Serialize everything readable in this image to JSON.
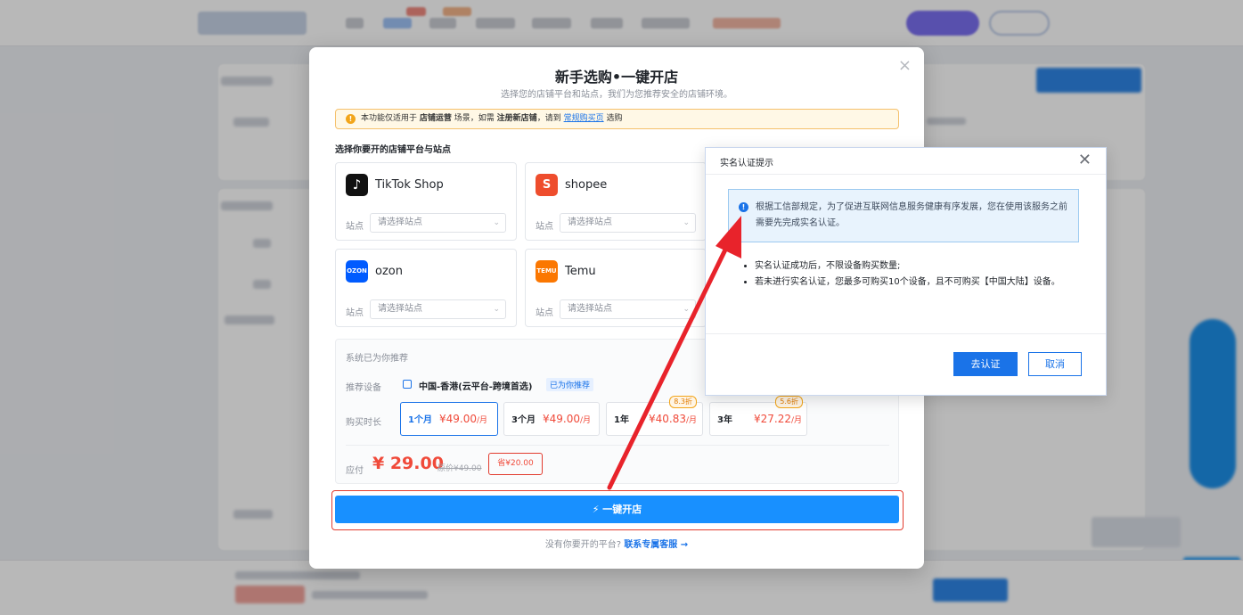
{
  "dialog": {
    "title": "新手选购•一键开店",
    "subtitle": "选择您的店铺平台和站点，我们为您推荐安全的店铺环境。",
    "close_icon": "×",
    "notice": {
      "icon": "!",
      "prefix": "本功能仅适用于",
      "bold1": "店铺运营",
      "mid1": "场景，如需",
      "bold2": "注册新店铺",
      "mid2": "，请到",
      "link": "常规购买页",
      "suffix": "选购"
    },
    "section_title": "选择你要开的店铺平台与站点",
    "platforms": [
      {
        "name": "TikTok Shop",
        "logo": "♪",
        "logo_color": "#111111",
        "site_label": "站点",
        "placeholder": "请选择站点"
      },
      {
        "name": "shopee",
        "logo": "S",
        "logo_color": "#ee4d2d",
        "site_label": "站点",
        "placeholder": "请选择站点"
      },
      {
        "name": "ozon",
        "logo": "OZON",
        "logo_color": "#005bff",
        "site_label": "站点",
        "placeholder": "请选择站点"
      },
      {
        "name": "Temu",
        "logo": "TEMU",
        "logo_color": "#fb7701",
        "site_label": "站点",
        "placeholder": "请选择站点"
      }
    ],
    "recommend": {
      "title": "系统已为你推荐",
      "device_label": "推荐设备",
      "device": "中国-香港(云平台-跨境首选)",
      "device_badge": "已为你推荐",
      "duration_label": "购买时长",
      "durations": [
        {
          "name": "1个月",
          "price": "¥49.00",
          "unit": "/月",
          "tag": "",
          "selected": true
        },
        {
          "name": "3个月",
          "price": "¥49.00",
          "unit": "/月",
          "tag": "",
          "selected": false
        },
        {
          "name": "1年",
          "price": "¥40.83",
          "unit": "/月",
          "tag": "8.3折",
          "selected": false
        },
        {
          "name": "3年",
          "price": "¥27.22",
          "unit": "/月",
          "tag": "5.6折",
          "selected": false
        }
      ],
      "pay_label": "应付",
      "pay_amount": "¥ 29.00",
      "original": "原价¥49.00",
      "save": "省¥20.00"
    },
    "main_button": "⚡ 一键开店",
    "footer_text": "没有你要开的平台?",
    "footer_link": "联系专属客服 →"
  },
  "realname": {
    "title": "实名认证提示",
    "close_icon": "✕",
    "info_icon": "!",
    "info": "根据工信部规定，为了促进互联网信息服务健康有序发展，您在使用该服务之前需要先完成实名认证。",
    "items": [
      "实名认证成功后，不限设备购买数量;",
      "若未进行实名认证，您最多可购买10个设备，且不可购买【中国大陆】设备。"
    ],
    "ok_button": "去认证",
    "cancel_button": "取消"
  },
  "colors": {
    "primary": "#1890ff",
    "price": "#f04a3a",
    "highlight": "#e23b2e",
    "warning": "#f2a51a"
  }
}
